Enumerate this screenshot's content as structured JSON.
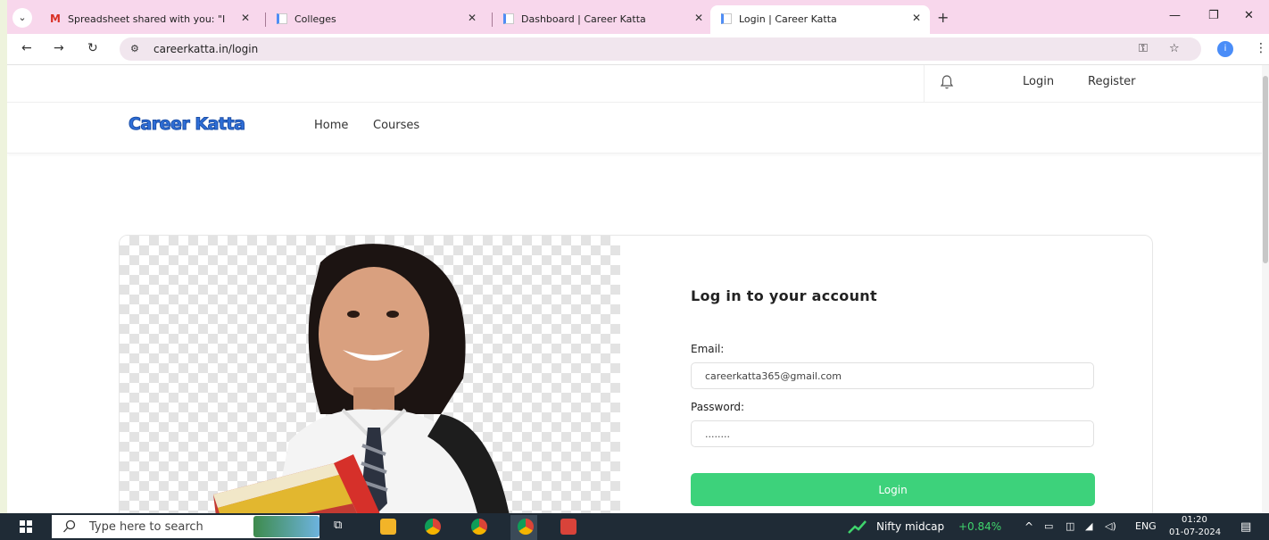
{
  "browser": {
    "tabs": [
      {
        "title": "Spreadsheet shared with you: \"I",
        "close": "✕"
      },
      {
        "title": "Colleges",
        "close": "✕"
      },
      {
        "title": "Dashboard | Career Katta",
        "close": "✕"
      },
      {
        "title": "Login | Career Katta",
        "close": "✕"
      }
    ],
    "new_tab": "+",
    "url": "careerkatta.in/login",
    "profile_initial": "i"
  },
  "page": {
    "top_links": {
      "login": "Login",
      "register": "Register"
    },
    "logo_text": "Career Katta",
    "nav": {
      "home": "Home",
      "courses": "Courses"
    },
    "form": {
      "title": "Log in to your account",
      "email_label": "Email:",
      "email_value": "careerkatta365@gmail.com",
      "password_label": "Password:",
      "password_value": "........",
      "submit_label": "Login"
    },
    "colors": {
      "accent_green": "#3dd27b",
      "logo_blue": "#2f6fd8"
    }
  },
  "taskbar": {
    "search_placeholder": "Type here to search",
    "ticker_name": "Nifty midcap",
    "ticker_change": "+0.84%",
    "language": "ENG",
    "time": "01:20",
    "date": "01-07-2024"
  }
}
